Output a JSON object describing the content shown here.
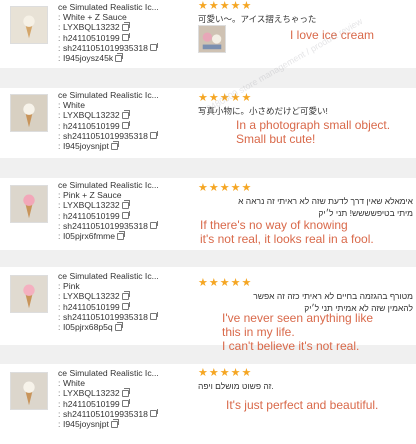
{
  "rows": [
    {
      "product": {
        "title": "ce Simulated Realistic Ic...",
        "attributes": [
          {
            "value": "White + Z Sauce",
            "copyable": false
          },
          {
            "value": "LYXBQL13232",
            "copyable": true
          },
          {
            "value": "h24110510199",
            "copyable": true
          },
          {
            "value": "sh241105101993531​8",
            "copyable": true
          },
          {
            "value": "I945joysz45k",
            "copyable": true
          }
        ]
      },
      "review": {
        "rating": 5,
        "text": "可愛い～。アイス摺えちゃった",
        "has_photo": true,
        "translation": "I love ice cream"
      }
    },
    {
      "product": {
        "title": "ce Simulated Realistic Ic...",
        "attributes": [
          {
            "value": "White",
            "copyable": false
          },
          {
            "value": "LYXBQL13232",
            "copyable": true
          },
          {
            "value": "h24110510199",
            "copyable": true
          },
          {
            "value": "sh241105101993531​8",
            "copyable": true
          },
          {
            "value": "I945joysnjpt",
            "copyable": true
          }
        ]
      },
      "review": {
        "rating": 5,
        "text": "写真小物に。小さめだけど可愛い!",
        "has_photo": false,
        "translation": "In a photograph small object.\nSmall but cute!"
      }
    },
    {
      "product": {
        "title": "ce Simulated Realistic Ic...",
        "attributes": [
          {
            "value": "Pink + Z Sauce",
            "copyable": false
          },
          {
            "value": "LYXBQL13232",
            "copyable": true
          },
          {
            "value": "h24110510199",
            "copyable": true
          },
          {
            "value": "sh241105101993531​8",
            "copyable": true
          },
          {
            "value": "I05pjrx6fmme",
            "copyable": true
          }
        ]
      },
      "review": {
        "rating": 5,
        "text": "אימאלא שאין דרך לדעת שזה לא ראיתי זה נראה א",
        "text2": "מיתי בטיפשששש! תני ל׳יק",
        "has_photo": false,
        "translation": "If there's no way of knowing\nit's not real, it looks real in a fool."
      }
    },
    {
      "product": {
        "title": "ce Simulated Realistic Ic...",
        "attributes": [
          {
            "value": "Pink",
            "copyable": false
          },
          {
            "value": "LYXBQL13232",
            "copyable": true
          },
          {
            "value": "h24110510199",
            "copyable": true
          },
          {
            "value": "sh241105101993531​8",
            "copyable": true
          },
          {
            "value": "I05pjrx68p5q",
            "copyable": true
          }
        ]
      },
      "review": {
        "rating": 5,
        "text": "מטורף בהגזמה בחיים לא ראיתי כזה זה אפשר",
        "text2": "להאמין שזה לא אמיתי תני ל׳יק",
        "has_photo": false,
        "translation": "I've never seen anything like\n this in my life.\n I can't believe it's not real."
      }
    },
    {
      "product": {
        "title": "ce Simulated Realistic Ic...",
        "attributes": [
          {
            "value": "White",
            "copyable": false
          },
          {
            "value": "LYXBQL13232",
            "copyable": true
          },
          {
            "value": "h24110510199",
            "copyable": true
          },
          {
            "value": "sh241105101993531​8",
            "copyable": true
          },
          {
            "value": "I945joysnjpt",
            "copyable": true
          }
        ]
      },
      "review": {
        "rating": 5,
        "text": ".זה פשוט מושלם ויפה",
        "has_photo": false,
        "translation": "It's just perfect and beautiful."
      }
    }
  ],
  "watermark": "2480309 store management / product review",
  "colors": {
    "star": "#f5a623",
    "translation": "#d9694a",
    "divider": "#f0f0f0"
  }
}
